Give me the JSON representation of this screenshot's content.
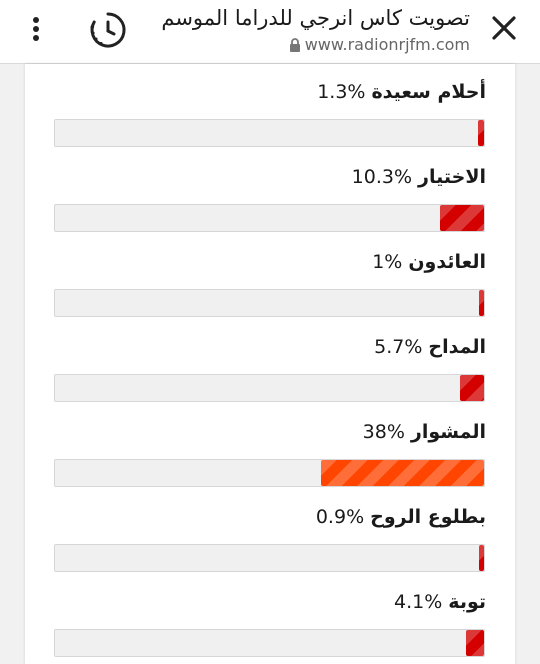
{
  "header": {
    "title": "تصويت كاس انرجي للدراما الموسم",
    "url": "www.radionrjfm.com"
  },
  "icons": {
    "menu": "vertical-dots-icon",
    "timer": "timer-icon",
    "close": "close-icon",
    "lock": "lock-icon"
  },
  "colors": {
    "bar_red": "#d40000",
    "bar_orange": "#ff4500",
    "track": "#f0f0f0"
  },
  "poll": {
    "options": [
      {
        "name": "أحلام سعيدة",
        "percent_label": "%1.3",
        "value": 1.3
      },
      {
        "name": "الاختيار",
        "percent_label": "%10.3",
        "value": 10.3
      },
      {
        "name": "العائدون",
        "percent_label": "%1",
        "value": 1
      },
      {
        "name": "المداح",
        "percent_label": "%5.7",
        "value": 5.7
      },
      {
        "name": "المشوار",
        "percent_label": "%38",
        "value": 38
      },
      {
        "name": "بطلوع الروح",
        "percent_label": "%0.9",
        "value": 0.9
      },
      {
        "name": "توبة",
        "percent_label": "%4.1",
        "value": 4.1
      }
    ]
  }
}
